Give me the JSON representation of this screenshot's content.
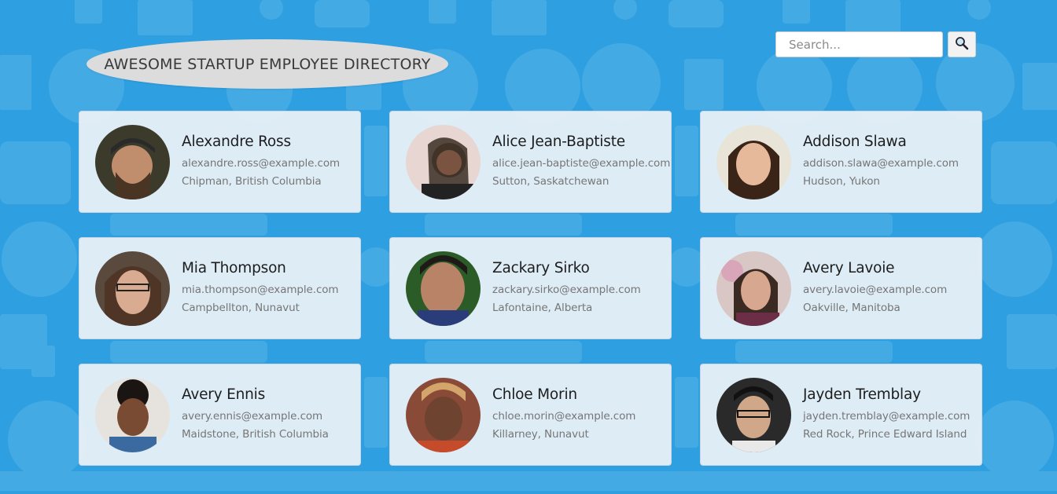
{
  "header": {
    "title": "AWESOME STARTUP EMPLOYEE DIRECTORY",
    "search_placeholder": "Search...",
    "search_icon": "magnifier-icon"
  },
  "colors": {
    "background": "#2e9fe0",
    "card": "#eef3f8",
    "title_pill": "#dcdcdc"
  },
  "employees": [
    {
      "name": "Alexandre Ross",
      "email": "alexandre.ross@example.com",
      "location": "Chipman, British Columbia"
    },
    {
      "name": "Alice Jean-Baptiste",
      "email": "alice.jean-baptiste@example.com",
      "location": "Sutton, Saskatchewan"
    },
    {
      "name": "Addison Slawa",
      "email": "addison.slawa@example.com",
      "location": "Hudson, Yukon"
    },
    {
      "name": "Mia Thompson",
      "email": "mia.thompson@example.com",
      "location": "Campbellton, Nunavut"
    },
    {
      "name": "Zackary Sirko",
      "email": "zackary.sirko@example.com",
      "location": "Lafontaine, Alberta"
    },
    {
      "name": "Avery Lavoie",
      "email": "avery.lavoie@example.com",
      "location": "Oakville, Manitoba"
    },
    {
      "name": "Avery Ennis",
      "email": "avery.ennis@example.com",
      "location": "Maidstone, British Columbia"
    },
    {
      "name": "Chloe Morin",
      "email": "chloe.morin@example.com",
      "location": "Killarney, Nunavut"
    },
    {
      "name": "Jayden Tremblay",
      "email": "jayden.tremblay@example.com",
      "location": "Red Rock, Prince Edward Island"
    }
  ]
}
